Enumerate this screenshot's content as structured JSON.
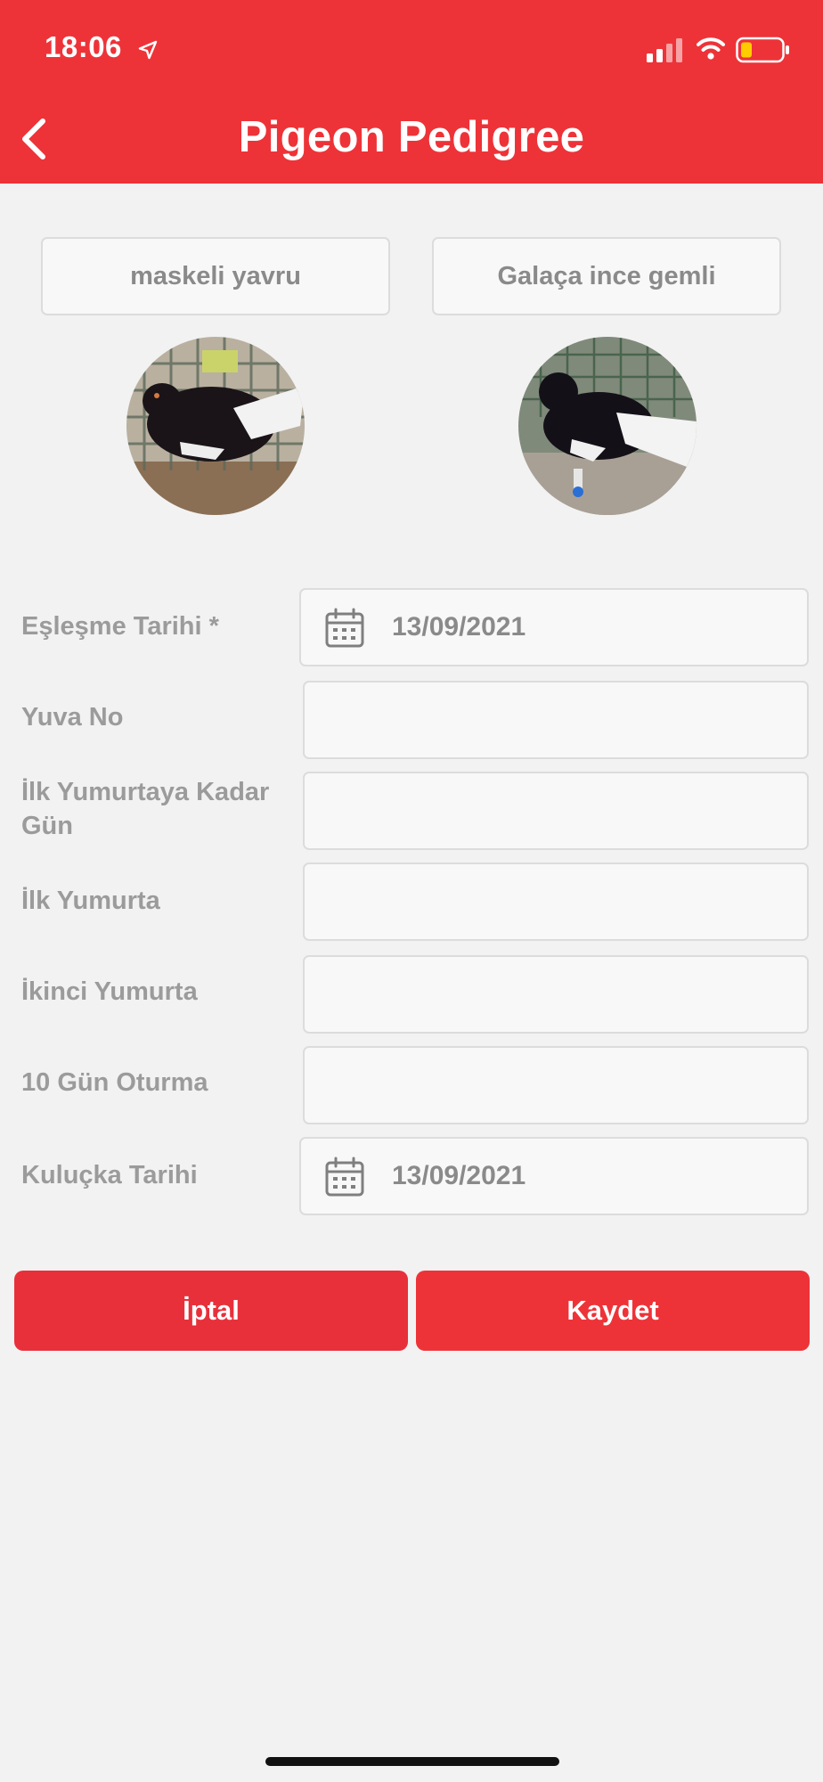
{
  "status_bar": {
    "time": "18:06"
  },
  "header": {
    "title": "Pigeon Pedigree",
    "color": "#ee3338"
  },
  "pair": {
    "left_name": "maskeli yavru",
    "right_name": "Galaça ince gemli"
  },
  "form": {
    "fields": [
      {
        "label": "Eşleşme Tarihi *",
        "value": "13/09/2021",
        "type": "date"
      },
      {
        "label": "Yuva No",
        "value": ""
      },
      {
        "label": "İlk Yumurtaya Kadar Gün",
        "value": ""
      },
      {
        "label": "İlk Yumurta",
        "value": ""
      },
      {
        "label": "İkinci Yumurta",
        "value": ""
      },
      {
        "label": "10 Gün Oturma",
        "value": ""
      },
      {
        "label": "Kuluçka Tarihi",
        "value": "13/09/2021",
        "type": "date"
      }
    ]
  },
  "actions": {
    "cancel_label": "İptal",
    "save_label": "Kaydet",
    "cancel_color": "#e8303a",
    "save_color": "#ee3338"
  },
  "icons": {
    "back": "chevron-left-icon",
    "calendar": "calendar-icon",
    "location": "location-arrow-icon",
    "signal": "cellular-signal-icon",
    "wifi": "wifi-icon",
    "battery": "battery-low-icon"
  }
}
